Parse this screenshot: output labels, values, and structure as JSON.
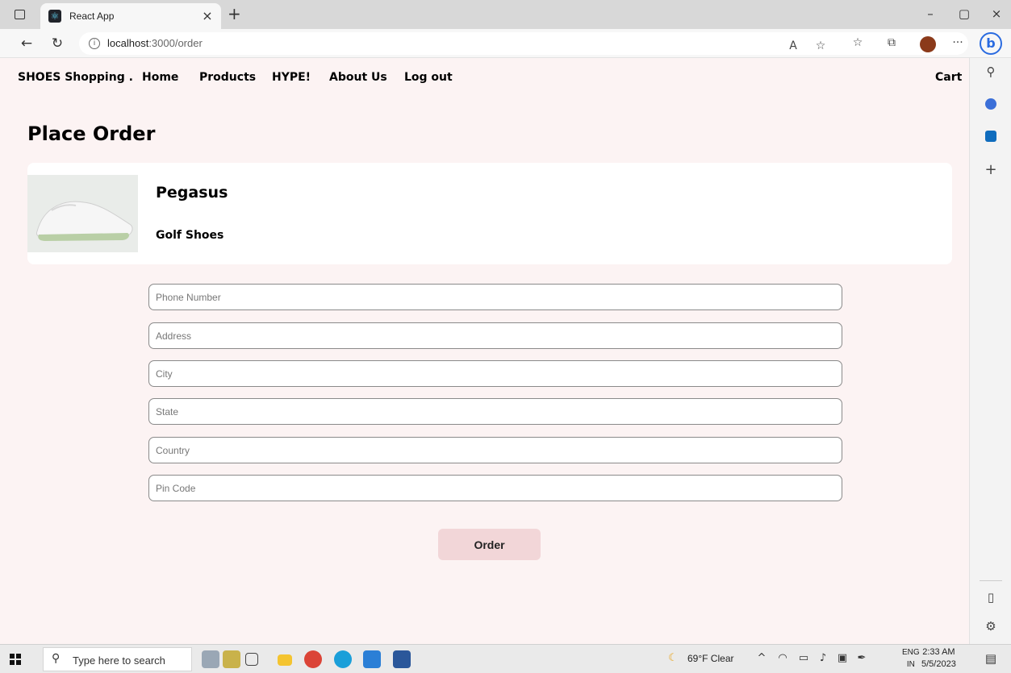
{
  "browser": {
    "tab_title": "React App",
    "tab_close": "×",
    "new_tab": "+",
    "url_host": "localhost",
    "url_path": ":3000/order",
    "minimize": "–",
    "restore": "▢",
    "close": "×"
  },
  "navbar": {
    "brand": "SHOES Shopping .",
    "links": [
      "Home",
      "Products",
      "HYPE!",
      "About Us",
      "Log out"
    ],
    "cart": "Cart"
  },
  "page": {
    "title": "Place Order"
  },
  "product": {
    "name": "Pegasus",
    "category": "Golf Shoes"
  },
  "form": {
    "fields": [
      {
        "placeholder": "Phone Number",
        "value": ""
      },
      {
        "placeholder": "Address",
        "value": ""
      },
      {
        "placeholder": "City",
        "value": ""
      },
      {
        "placeholder": "State",
        "value": ""
      },
      {
        "placeholder": "Country",
        "value": ""
      },
      {
        "placeholder": "Pin Code",
        "value": ""
      }
    ],
    "submit_label": "Order"
  },
  "taskbar": {
    "search_placeholder": "Type here to search",
    "weather": "69°F  Clear",
    "lang_top": "ENG",
    "lang_bottom": "IN",
    "time": "2:33 AM",
    "date": "5/5/2023"
  },
  "icons": {
    "back": "back-arrow-icon",
    "refresh": "refresh-icon",
    "info": "info-icon",
    "read_aloud": "read-aloud-icon",
    "favorite": "add-favorite-icon",
    "favorites": "favorites-icon",
    "collections": "collections-icon",
    "more": "more-icon",
    "bing": "bing-icon"
  },
  "colors": {
    "page_background": "#fcf3f3",
    "order_button": "#f2d6d8",
    "card_background": "#ffffff"
  }
}
